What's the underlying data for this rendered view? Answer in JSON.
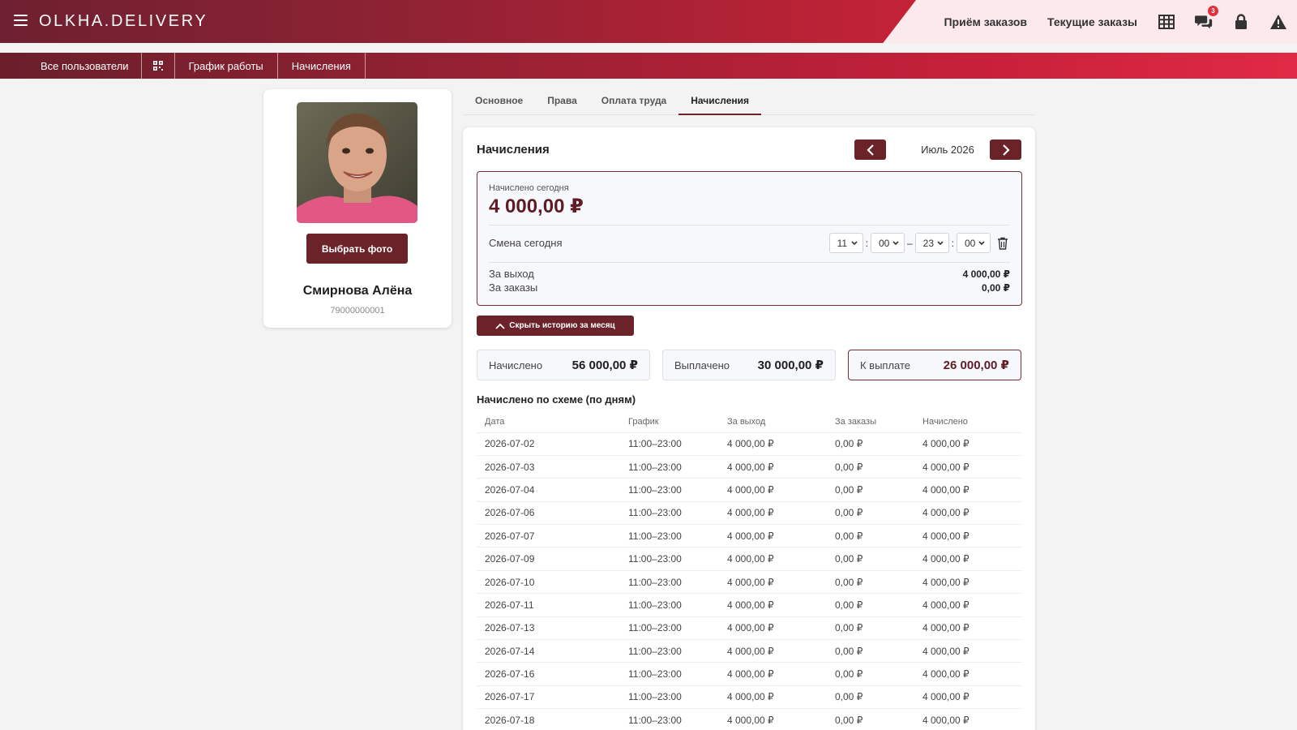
{
  "header": {
    "logo": "OLKHA.DELIVERY",
    "links": [
      "Приём заказов",
      "Текущие заказы"
    ],
    "icons": [
      "grid-icon",
      "chat-icon",
      "lock-icon",
      "warning-icon"
    ],
    "chat_badge": "3",
    "colors": {
      "brand_dark": "#6e2030",
      "brand_red": "#c42236",
      "accent": "#6b2228"
    }
  },
  "subnav": {
    "all_users": "Все пользователи",
    "schedule": "График работы",
    "accruals": "Начисления"
  },
  "profile": {
    "choose_photo": "Выбрать фото",
    "name": "Смирнова Алёна",
    "phone": "79000000001"
  },
  "tabs": [
    "Основное",
    "Права",
    "Оплата труда",
    "Начисления"
  ],
  "active_tab": "Начисления",
  "panel": {
    "title": "Начисления",
    "month": "Июль 2026",
    "today_label": "Начислено сегодня",
    "today_amount": "4 000,00 ₽",
    "shift_label": "Смена сегодня",
    "shift": {
      "start_h": "11",
      "start_m": "00",
      "end_h": "23",
      "end_m": "00",
      "sep_colon": ":",
      "sep_dash": "–"
    },
    "per_shift_label": "За выход",
    "per_shift_value": "4 000,00 ₽",
    "per_orders_label": "За заказы",
    "per_orders_value": "0,00 ₽",
    "history_btn": "Скрыть историю за месяц",
    "stats": [
      {
        "label": "Начислено",
        "value": "56 000,00 ₽"
      },
      {
        "label": "Выплачено",
        "value": "30 000,00 ₽"
      },
      {
        "label": "К выплате",
        "value": "26 000,00 ₽"
      }
    ],
    "section_title": "Начислено по схеме (по дням)",
    "table": {
      "columns": [
        "Дата",
        "График",
        "За выход",
        "За заказы",
        "Начислено"
      ],
      "rows": [
        [
          "2026-07-02",
          "11:00–23:00",
          "4 000,00 ₽",
          "0,00 ₽",
          "4 000,00 ₽"
        ],
        [
          "2026-07-03",
          "11:00–23:00",
          "4 000,00 ₽",
          "0,00 ₽",
          "4 000,00 ₽"
        ],
        [
          "2026-07-04",
          "11:00–23:00",
          "4 000,00 ₽",
          "0,00 ₽",
          "4 000,00 ₽"
        ],
        [
          "2026-07-06",
          "11:00–23:00",
          "4 000,00 ₽",
          "0,00 ₽",
          "4 000,00 ₽"
        ],
        [
          "2026-07-07",
          "11:00–23:00",
          "4 000,00 ₽",
          "0,00 ₽",
          "4 000,00 ₽"
        ],
        [
          "2026-07-09",
          "11:00–23:00",
          "4 000,00 ₽",
          "0,00 ₽",
          "4 000,00 ₽"
        ],
        [
          "2026-07-10",
          "11:00–23:00",
          "4 000,00 ₽",
          "0,00 ₽",
          "4 000,00 ₽"
        ],
        [
          "2026-07-11",
          "11:00–23:00",
          "4 000,00 ₽",
          "0,00 ₽",
          "4 000,00 ₽"
        ],
        [
          "2026-07-13",
          "11:00–23:00",
          "4 000,00 ₽",
          "0,00 ₽",
          "4 000,00 ₽"
        ],
        [
          "2026-07-14",
          "11:00–23:00",
          "4 000,00 ₽",
          "0,00 ₽",
          "4 000,00 ₽"
        ],
        [
          "2026-07-16",
          "11:00–23:00",
          "4 000,00 ₽",
          "0,00 ₽",
          "4 000,00 ₽"
        ],
        [
          "2026-07-17",
          "11:00–23:00",
          "4 000,00 ₽",
          "0,00 ₽",
          "4 000,00 ₽"
        ],
        [
          "2026-07-18",
          "11:00–23:00",
          "4 000,00 ₽",
          "0,00 ₽",
          "4 000,00 ₽"
        ]
      ]
    }
  }
}
